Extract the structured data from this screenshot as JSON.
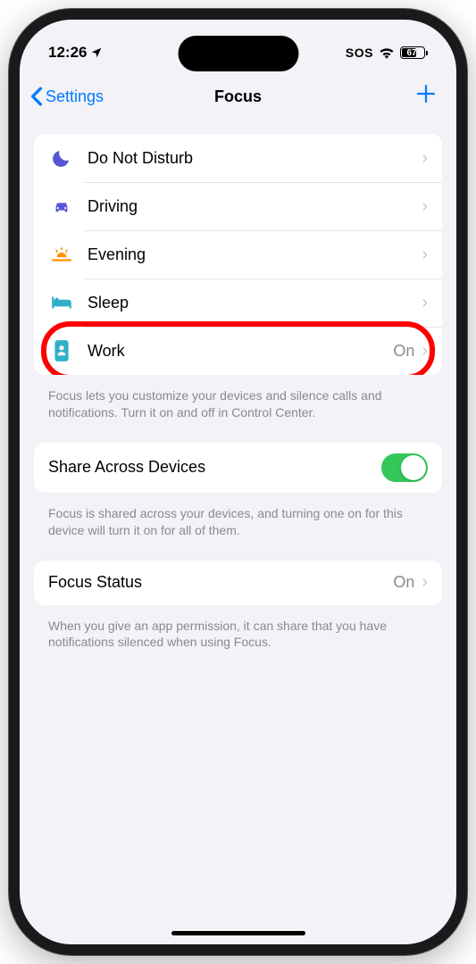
{
  "statusBar": {
    "time": "12:26",
    "sos": "SOS",
    "battery": "67"
  },
  "nav": {
    "back": "Settings",
    "title": "Focus"
  },
  "modes": [
    {
      "label": "Do Not Disturb",
      "icon": "moon",
      "color": "#5856d6",
      "status": ""
    },
    {
      "label": "Driving",
      "icon": "car",
      "color": "#5856d6",
      "status": ""
    },
    {
      "label": "Evening",
      "icon": "sunset",
      "color": "#ff9500",
      "status": ""
    },
    {
      "label": "Sleep",
      "icon": "bed",
      "color": "#30b0c7",
      "status": ""
    },
    {
      "label": "Work",
      "icon": "badge",
      "color": "#30b0c7",
      "status": "On"
    }
  ],
  "modesFooter": "Focus lets you customize your devices and silence calls and notifications. Turn it on and off in Control Center.",
  "share": {
    "label": "Share Across Devices",
    "footer": "Focus is shared across your devices, and turning one on for this device will turn it on for all of them."
  },
  "focusStatus": {
    "label": "Focus Status",
    "value": "On",
    "footer": "When you give an app permission, it can share that you have notifications silenced when using Focus."
  }
}
